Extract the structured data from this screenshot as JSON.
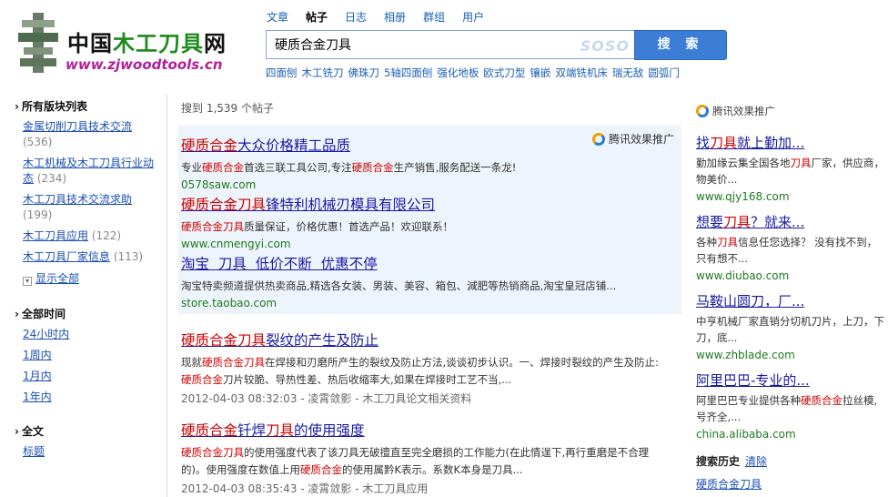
{
  "logo": {
    "cn_prefix": "中国",
    "cn_green": "木工刀具",
    "cn_suffix": "网",
    "en": "www.zjwoodtools.cn"
  },
  "nav": {
    "tabs": [
      "文章",
      "帖子",
      "日志",
      "相册",
      "群组",
      "用户"
    ],
    "active": "帖子"
  },
  "search": {
    "value": "硬质合金刀具",
    "engine_mark": "SOSO",
    "button_label": "搜 索"
  },
  "hot_links": [
    "四面刨",
    "木工铣刀",
    "佛珠刀",
    "5轴四面刨",
    "强化地板",
    "欧式刀型",
    "镶嵌",
    "双端铣机床",
    "瑞无敌",
    "圆弧门"
  ],
  "sidebar": {
    "boards_title": "所有版块列表",
    "boards": [
      {
        "name": "金属切削刀具技术交流",
        "count": "(536)"
      },
      {
        "name": "木工机械及木工刀具行业动态",
        "count": "(234)"
      },
      {
        "name": "木工刀具技术交流求助",
        "count": "(199)"
      },
      {
        "name": "木工刀具应用",
        "count": "(122)"
      },
      {
        "name": "木工刀具厂家信息",
        "count": "(113)"
      }
    ],
    "show_all": "显示全部",
    "time_title": "全部时间",
    "times": [
      "24小时内",
      "1周内",
      "1月内",
      "1年内"
    ],
    "text_title": "全文",
    "text_options": [
      "标题"
    ]
  },
  "results": {
    "count_text": "搜到 1,539 个帖子",
    "ad_label": "腾讯效果推广",
    "ads": [
      {
        "title_hl": "硬质合金",
        "title_rest": "大众价格精工品质",
        "desc_pre": "专业",
        "desc_hl1": "硬质合金",
        "desc_mid": "首选三联工具公司,专注",
        "desc_hl2": "硬质合金",
        "desc_post": "生产销售,服务配送一条龙!",
        "url": "0578saw.com"
      },
      {
        "title_hl": "硬质合金刀具",
        "title_rest": "锋特利机械刃模具有限公司",
        "desc_pre": "",
        "desc_hl1": "硬质合金刀具",
        "desc_mid": "质量保证，价格优惠！首选产品！欢迎联系！",
        "desc_hl2": "",
        "desc_post": "",
        "url": "www.cnmengyi.com"
      },
      {
        "title_hl": "淘宝",
        "title_rest": "  刀具  低价不断  优惠不停",
        "desc_pre": "",
        "desc_hl1": "",
        "desc_mid": "淘宝特卖频道提供热卖商品,精选各女装、男装、美容、箱包、減肥等热销商品,淘宝皇冠店铺...",
        "desc_hl2": "",
        "desc_post": "",
        "url": "store.taobao.com"
      }
    ],
    "posts": [
      {
        "title_hl": "硬质合金刀具",
        "title_rest": "裂纹的产生及防止",
        "line1_pre": "现就",
        "line1_hl": "硬质合金刀具",
        "line1_post": "在焊接和刃磨所产生的裂纹及防止方法,谈谈初步认识。一、焊接时裂纹的产生及防止:",
        "line2_hl": "硬质合金",
        "line2_post": "刀片较脆、导热性差、热后收缩率大,如果在焊接时工艺不当,...",
        "meta": "2012-04-03 08:32:03 - 凌霄敛影 - 木工刀具论文相关资料"
      },
      {
        "title_hl": "硬质合金",
        "title_mid": "钎焊",
        "title_hl2": "刀具",
        "title_rest": "的使用强度",
        "line1_pre": "",
        "line1_hl": "硬质合金刀具",
        "line1_post": "的使用强度代表了该刀具无破擅直至完全磨损的工作能力(在此情逞下,再行重磨是不合理",
        "line2_pre": "的)。使用强度在数值上用",
        "line2_hl": "硬质合金",
        "line2_post": "的使用属黔K表示。系数K本身是刀具...",
        "meta": "2012-04-03 08:35:43 - 凌霄敛影 - 木工刀具应用"
      }
    ]
  },
  "right_column": {
    "label": "腾讯效果推广",
    "ads": [
      {
        "title_pre": "找",
        "title_hl": "刀具",
        "title_post": "就上勤加...",
        "line1_pre": "勤加缘云集全国各地",
        "line1_hl": "刀具",
        "line1_post": "厂家，供应商，",
        "line2": "物美价...",
        "url": "www.qjy168.com"
      },
      {
        "title_pre": "想要",
        "title_hl": "刀具",
        "title_post": "？就来...",
        "line1_pre": "各种",
        "line1_hl": "刀具",
        "line1_post": "信息任您选择？ 没有找不到，",
        "line2": "只有想不...",
        "url": "www.diubao.com"
      },
      {
        "title_pre": "马鞍山圆刀，厂...",
        "title_hl": "",
        "title_post": "",
        "line1_pre": "中亨机械厂家直销分切机刀片，上刀，下",
        "line1_hl": "",
        "line1_post": "",
        "line2": "刀，底...",
        "url": "www.zhblade.com"
      },
      {
        "title_pre": "阿里巴巴-专业的...",
        "title_hl": "",
        "title_post": "",
        "line1_pre": "阿里巴巴专业提供各种",
        "line1_hl": "硬质合金",
        "line1_post": "拉丝模,",
        "line2": "号齐全,...",
        "url": "china.alibaba.com"
      }
    ],
    "history_title": "搜索历史",
    "history_clear": "清除",
    "history_items": [
      "硬质合金刀具"
    ]
  }
}
